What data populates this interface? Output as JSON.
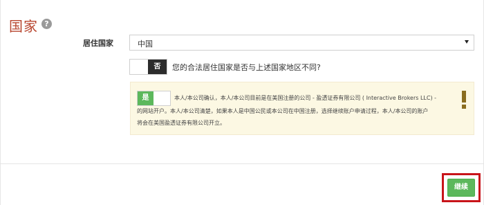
{
  "section": {
    "title": "国家",
    "help_icon_glyph": "?"
  },
  "residence": {
    "label": "居住国家",
    "selected_value": "中国"
  },
  "toggle_different_country": {
    "state_label": "否",
    "question": "您的合法居住国家是否与上述国家地区不同?"
  },
  "confirmation": {
    "toggle_state_label": "是",
    "line1": "本人/本公司确认，本人/本公司目前是在美国注册的公司 - 盈透证券有限公司 ( Interactive Brokers LLC) -",
    "line2": "的网站开户。本人/本公司清楚，如果本人是中国公民或本公司在中国注册，选择继续账户申请过程，本人/本公司的账户",
    "line3": "将会在美国盈透证券有限公司开立。"
  },
  "footer": {
    "continue_label": "继续"
  },
  "colors": {
    "title": "#b8462f",
    "success": "#5cb85c",
    "warning": "#8a6d1f",
    "alert_bg": "#fcf8e3",
    "highlight_frame": "#c8141a"
  }
}
